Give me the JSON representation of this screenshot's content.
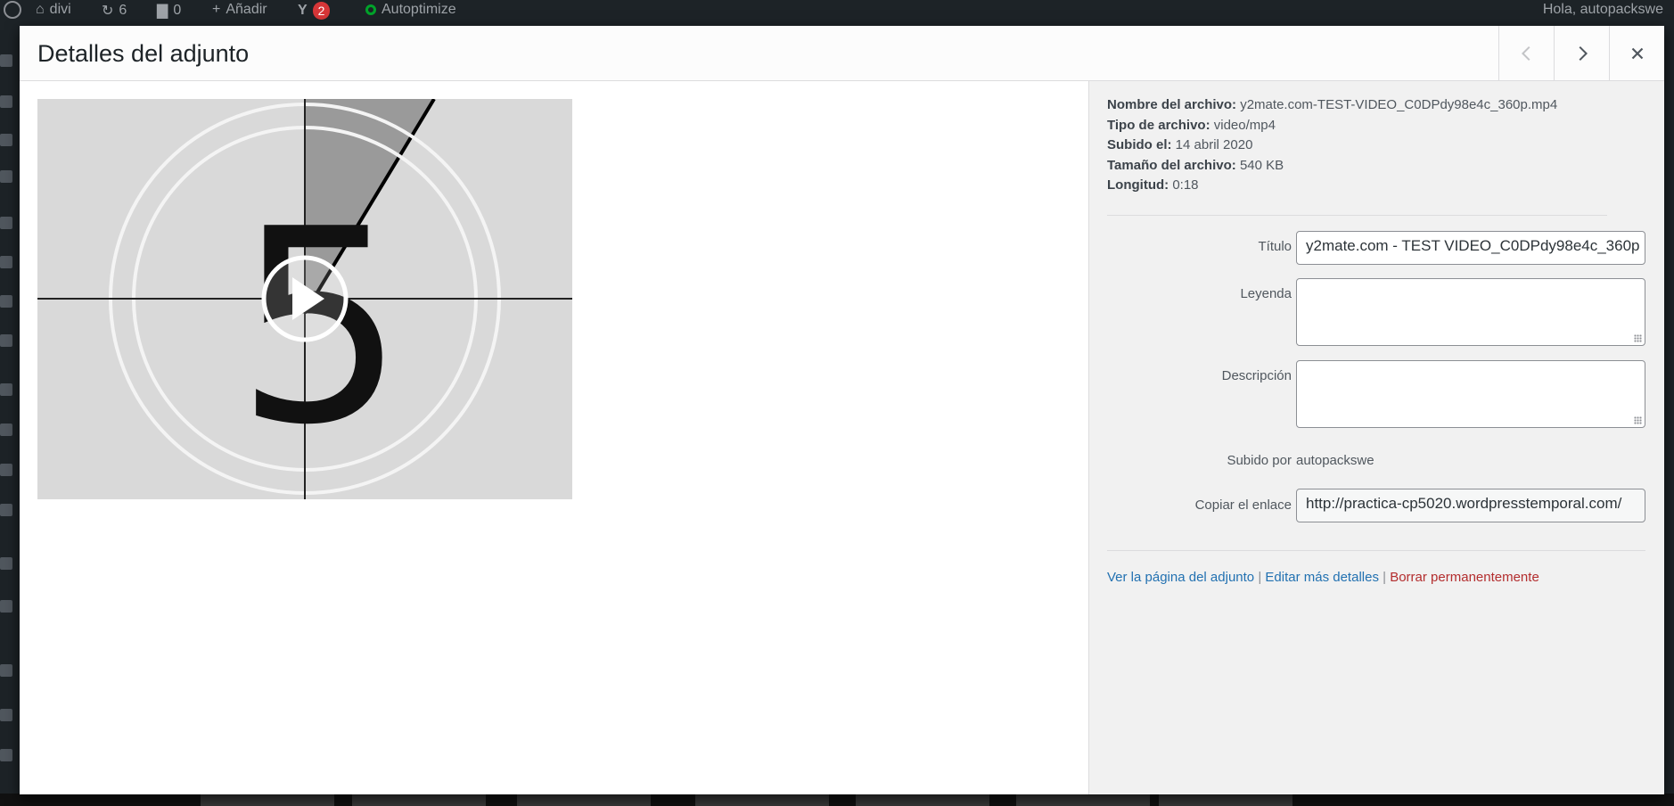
{
  "admin_bar": {
    "site_name": "divi",
    "updates_count": "6",
    "comments_count": "0",
    "new_label": "Añadir",
    "yoast_badge": "2",
    "autoptimize_label": "Autoptimize",
    "greeting": "Hola, autopackswe"
  },
  "modal": {
    "title": "Detalles del adjunto",
    "prev_icon": "chevron-left-icon",
    "next_icon": "chevron-right-icon",
    "close_icon": "close-icon"
  },
  "attachment": {
    "filename_label": "Nombre del archivo:",
    "filename": "y2mate.com-TEST-VIDEO_C0DPdy98e4c_360p.mp4",
    "filetype_label": "Tipo de archivo:",
    "filetype": "video/mp4",
    "uploaded_label": "Subido el:",
    "uploaded": "14 abril 2020",
    "filesize_label": "Tamaño del archivo:",
    "filesize": "540 KB",
    "length_label": "Longitud:",
    "length": "0:18",
    "video_frame_number": "5"
  },
  "fields": {
    "title_label": "Título",
    "title_value": "y2mate.com - TEST VIDEO_C0DPdy98e4c_360p",
    "caption_label": "Leyenda",
    "caption_value": "",
    "description_label": "Descripción",
    "description_value": "",
    "uploaded_by_label": "Subido por",
    "uploaded_by": "autopackswe",
    "copy_link_label": "Copiar el enlace",
    "copy_link_value": "http://practica-cp5020.wordpresstemporal.com/"
  },
  "actions": {
    "view_page": "Ver la página del adjunto",
    "edit_details": "Editar más detalles",
    "delete": "Borrar permanentemente",
    "separator": "|"
  },
  "colors": {
    "link": "#2271b1",
    "delete": "#b32d2e",
    "badge": "#d63638"
  }
}
